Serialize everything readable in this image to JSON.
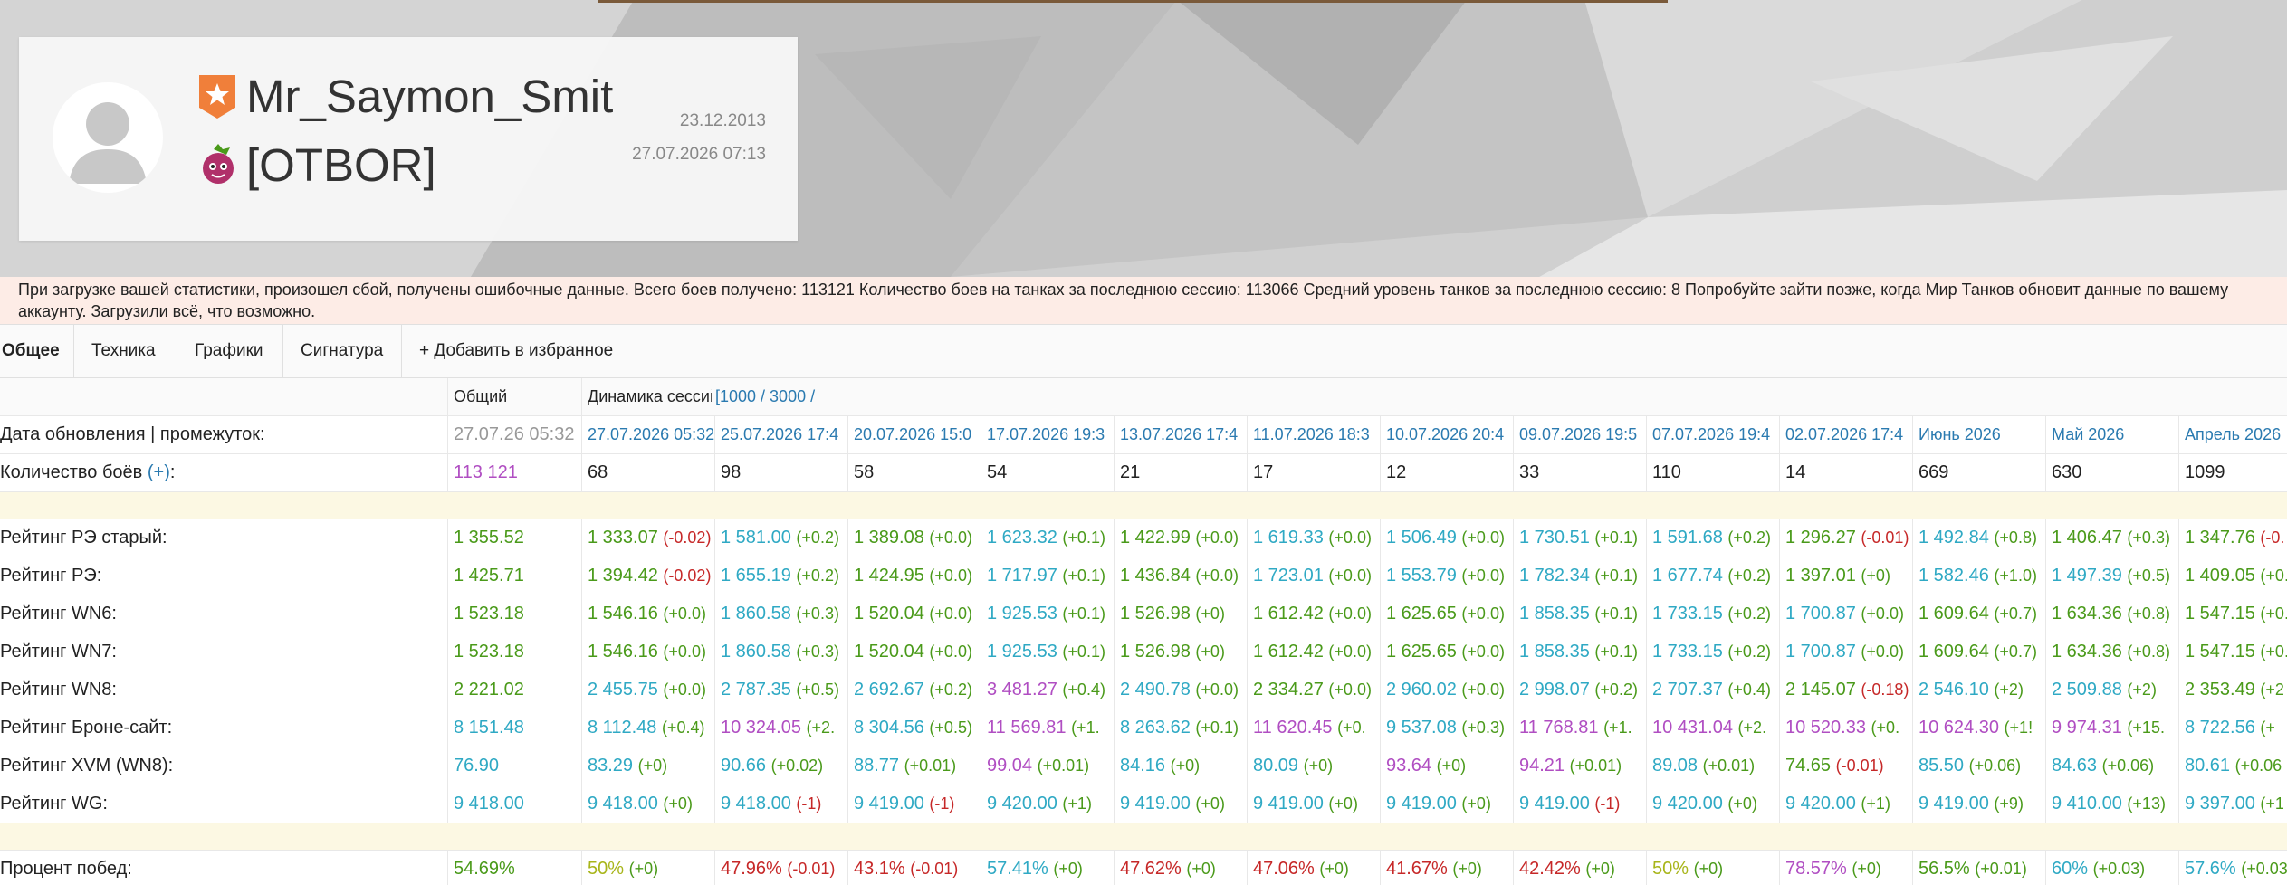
{
  "player": {
    "nickname": "Mr_Saymon_Smit",
    "clan": "[OTBOR]",
    "registered": "23.12.2013",
    "last_battle": "27.07.2026 07:13"
  },
  "alert": "При загрузке вашей статистики, произошел сбой, получены ошибочные данные. Всего боев получено: 113121 Количество боев на танках за последнюю сессию: 113066 Средний уровень танков за последнюю сессию: 8 Попробуйте зайти позже, когда Мир Танков обновит данные по вашему аккаунту. Загрузили всё, что возможно.",
  "tabs": [
    "Общее",
    "Техника",
    "Графики",
    "Сигнатура",
    "+ Добавить в избранное"
  ],
  "table": {
    "header": {
      "total": "Общий",
      "dynamics": "Динамика сессий",
      "ranges": "[1000 / 3000 /"
    },
    "update_label": "Дата обновления | промежуток:",
    "update_total": "27.07.26 05:32",
    "update_dates": [
      "27.07.2026 05:32",
      "25.07.2026 17:4",
      "20.07.2026 15:0",
      "17.07.2026 19:3",
      "13.07.2026 17:4",
      "11.07.2026 18:3",
      "10.07.2026 20:4",
      "09.07.2026 19:5",
      "07.07.2026 19:4",
      "02.07.2026 17:4",
      "Июнь 2026",
      "Май 2026",
      "Апрель 2026"
    ],
    "battles_label": "Количество боёв",
    "battles_plus": "(+)",
    "battles_colon": ":",
    "battles_total": "113 121",
    "battles": [
      "68",
      "98",
      "58",
      "54",
      "21",
      "17",
      "12",
      "33",
      "110",
      "14",
      "669",
      "630",
      "1099"
    ],
    "rows": [
      {
        "label": "Рейтинг РЭ старый:",
        "total": "1 355.52",
        "total_color": "#4a9a1a",
        "cells": [
          {
            "v": "1 333.07",
            "d": "(-0.02)",
            "c": "#4a9a1a",
            "dc": "#c62828"
          },
          {
            "v": "1 581.00",
            "d": "(+0.2)",
            "c": "#2fa9c4",
            "dc": "#4a9a1a"
          },
          {
            "v": "1 389.08",
            "d": "(+0.0)",
            "c": "#4a9a1a",
            "dc": "#4a9a1a"
          },
          {
            "v": "1 623.32",
            "d": "(+0.1)",
            "c": "#2fa9c4",
            "dc": "#4a9a1a"
          },
          {
            "v": "1 422.99",
            "d": "(+0.0)",
            "c": "#4a9a1a",
            "dc": "#4a9a1a"
          },
          {
            "v": "1 619.33",
            "d": "(+0.0)",
            "c": "#2fa9c4",
            "dc": "#4a9a1a"
          },
          {
            "v": "1 506.49",
            "d": "(+0.0)",
            "c": "#2fa9c4",
            "dc": "#4a9a1a"
          },
          {
            "v": "1 730.51",
            "d": "(+0.1)",
            "c": "#2fa9c4",
            "dc": "#4a9a1a"
          },
          {
            "v": "1 591.68",
            "d": "(+0.2)",
            "c": "#2fa9c4",
            "dc": "#4a9a1a"
          },
          {
            "v": "1 296.27",
            "d": "(-0.01)",
            "c": "#4a9a1a",
            "dc": "#c62828"
          },
          {
            "v": "1 492.84",
            "d": "(+0.8)",
            "c": "#2fa9c4",
            "dc": "#4a9a1a"
          },
          {
            "v": "1 406.47",
            "d": "(+0.3)",
            "c": "#4a9a1a",
            "dc": "#4a9a1a"
          },
          {
            "v": "1 347.76",
            "d": "(-0.",
            "c": "#4a9a1a",
            "dc": "#c62828"
          }
        ]
      },
      {
        "label": "Рейтинг РЭ:",
        "total": "1 425.71",
        "total_color": "#4a9a1a",
        "cells": [
          {
            "v": "1 394.42",
            "d": "(-0.02)",
            "c": "#4a9a1a",
            "dc": "#c62828"
          },
          {
            "v": "1 655.19",
            "d": "(+0.2)",
            "c": "#2fa9c4",
            "dc": "#4a9a1a"
          },
          {
            "v": "1 424.95",
            "d": "(+0.0)",
            "c": "#4a9a1a",
            "dc": "#4a9a1a"
          },
          {
            "v": "1 717.97",
            "d": "(+0.1)",
            "c": "#2fa9c4",
            "dc": "#4a9a1a"
          },
          {
            "v": "1 436.84",
            "d": "(+0.0)",
            "c": "#4a9a1a",
            "dc": "#4a9a1a"
          },
          {
            "v": "1 723.01",
            "d": "(+0.0)",
            "c": "#2fa9c4",
            "dc": "#4a9a1a"
          },
          {
            "v": "1 553.79",
            "d": "(+0.0)",
            "c": "#2fa9c4",
            "dc": "#4a9a1a"
          },
          {
            "v": "1 782.34",
            "d": "(+0.1)",
            "c": "#2fa9c4",
            "dc": "#4a9a1a"
          },
          {
            "v": "1 677.74",
            "d": "(+0.2)",
            "c": "#2fa9c4",
            "dc": "#4a9a1a"
          },
          {
            "v": "1 397.01",
            "d": "(+0)",
            "c": "#4a9a1a",
            "dc": "#4a9a1a"
          },
          {
            "v": "1 582.46",
            "d": "(+1.0)",
            "c": "#2fa9c4",
            "dc": "#4a9a1a"
          },
          {
            "v": "1 497.39",
            "d": "(+0.5)",
            "c": "#2fa9c4",
            "dc": "#4a9a1a"
          },
          {
            "v": "1 409.05",
            "d": "(+0.",
            "c": "#4a9a1a",
            "dc": "#4a9a1a"
          }
        ]
      },
      {
        "label": "Рейтинг WN6:",
        "total": "1 523.18",
        "total_color": "#4a9a1a",
        "cells": [
          {
            "v": "1 546.16",
            "d": "(+0.0)",
            "c": "#4a9a1a",
            "dc": "#4a9a1a"
          },
          {
            "v": "1 860.58",
            "d": "(+0.3)",
            "c": "#2fa9c4",
            "dc": "#4a9a1a"
          },
          {
            "v": "1 520.04",
            "d": "(+0.0)",
            "c": "#4a9a1a",
            "dc": "#4a9a1a"
          },
          {
            "v": "1 925.53",
            "d": "(+0.1)",
            "c": "#2fa9c4",
            "dc": "#4a9a1a"
          },
          {
            "v": "1 526.98",
            "d": "(+0)",
            "c": "#4a9a1a",
            "dc": "#4a9a1a"
          },
          {
            "v": "1 612.42",
            "d": "(+0.0)",
            "c": "#4a9a1a",
            "dc": "#4a9a1a"
          },
          {
            "v": "1 625.65",
            "d": "(+0.0)",
            "c": "#4a9a1a",
            "dc": "#4a9a1a"
          },
          {
            "v": "1 858.35",
            "d": "(+0.1)",
            "c": "#2fa9c4",
            "dc": "#4a9a1a"
          },
          {
            "v": "1 733.15",
            "d": "(+0.2)",
            "c": "#2fa9c4",
            "dc": "#4a9a1a"
          },
          {
            "v": "1 700.87",
            "d": "(+0.0)",
            "c": "#2fa9c4",
            "dc": "#4a9a1a"
          },
          {
            "v": "1 609.64",
            "d": "(+0.7)",
            "c": "#4a9a1a",
            "dc": "#4a9a1a"
          },
          {
            "v": "1 634.36",
            "d": "(+0.8)",
            "c": "#4a9a1a",
            "dc": "#4a9a1a"
          },
          {
            "v": "1 547.15",
            "d": "(+0.",
            "c": "#4a9a1a",
            "dc": "#4a9a1a"
          }
        ]
      },
      {
        "label": "Рейтинг WN7:",
        "total": "1 523.18",
        "total_color": "#4a9a1a",
        "cells": [
          {
            "v": "1 546.16",
            "d": "(+0.0)",
            "c": "#4a9a1a",
            "dc": "#4a9a1a"
          },
          {
            "v": "1 860.58",
            "d": "(+0.3)",
            "c": "#2fa9c4",
            "dc": "#4a9a1a"
          },
          {
            "v": "1 520.04",
            "d": "(+0.0)",
            "c": "#4a9a1a",
            "dc": "#4a9a1a"
          },
          {
            "v": "1 925.53",
            "d": "(+0.1)",
            "c": "#2fa9c4",
            "dc": "#4a9a1a"
          },
          {
            "v": "1 526.98",
            "d": "(+0)",
            "c": "#4a9a1a",
            "dc": "#4a9a1a"
          },
          {
            "v": "1 612.42",
            "d": "(+0.0)",
            "c": "#4a9a1a",
            "dc": "#4a9a1a"
          },
          {
            "v": "1 625.65",
            "d": "(+0.0)",
            "c": "#4a9a1a",
            "dc": "#4a9a1a"
          },
          {
            "v": "1 858.35",
            "d": "(+0.1)",
            "c": "#2fa9c4",
            "dc": "#4a9a1a"
          },
          {
            "v": "1 733.15",
            "d": "(+0.2)",
            "c": "#2fa9c4",
            "dc": "#4a9a1a"
          },
          {
            "v": "1 700.87",
            "d": "(+0.0)",
            "c": "#2fa9c4",
            "dc": "#4a9a1a"
          },
          {
            "v": "1 609.64",
            "d": "(+0.7)",
            "c": "#4a9a1a",
            "dc": "#4a9a1a"
          },
          {
            "v": "1 634.36",
            "d": "(+0.8)",
            "c": "#4a9a1a",
            "dc": "#4a9a1a"
          },
          {
            "v": "1 547.15",
            "d": "(+0.",
            "c": "#4a9a1a",
            "dc": "#4a9a1a"
          }
        ]
      },
      {
        "label": "Рейтинг WN8:",
        "total": "2 221.02",
        "total_color": "#4a9a1a",
        "cells": [
          {
            "v": "2 455.75",
            "d": "(+0.0)",
            "c": "#2fa9c4",
            "dc": "#4a9a1a"
          },
          {
            "v": "2 787.35",
            "d": "(+0.5)",
            "c": "#2fa9c4",
            "dc": "#4a9a1a"
          },
          {
            "v": "2 692.67",
            "d": "(+0.2)",
            "c": "#2fa9c4",
            "dc": "#4a9a1a"
          },
          {
            "v": "3 481.27",
            "d": "(+0.4)",
            "c": "#b04ec2",
            "dc": "#4a9a1a"
          },
          {
            "v": "2 490.78",
            "d": "(+0.0)",
            "c": "#2fa9c4",
            "dc": "#4a9a1a"
          },
          {
            "v": "2 334.27",
            "d": "(+0.0)",
            "c": "#4a9a1a",
            "dc": "#4a9a1a"
          },
          {
            "v": "2 960.02",
            "d": "(+0.0)",
            "c": "#2fa9c4",
            "dc": "#4a9a1a"
          },
          {
            "v": "2 998.07",
            "d": "(+0.2)",
            "c": "#2fa9c4",
            "dc": "#4a9a1a"
          },
          {
            "v": "2 707.37",
            "d": "(+0.4)",
            "c": "#2fa9c4",
            "dc": "#4a9a1a"
          },
          {
            "v": "2 145.07",
            "d": "(-0.18)",
            "c": "#4a9a1a",
            "dc": "#c62828"
          },
          {
            "v": "2 546.10",
            "d": "(+2)",
            "c": "#2fa9c4",
            "dc": "#4a9a1a"
          },
          {
            "v": "2 509.88",
            "d": "(+2)",
            "c": "#2fa9c4",
            "dc": "#4a9a1a"
          },
          {
            "v": "2 353.49",
            "d": "(+2",
            "c": "#4a9a1a",
            "dc": "#4a9a1a"
          }
        ]
      },
      {
        "label": "Рейтинг Броне-сайт:",
        "total": "8 151.48",
        "total_color": "#2fa9c4",
        "cells": [
          {
            "v": "8 112.48",
            "d": "(+0.4)",
            "c": "#2fa9c4",
            "dc": "#4a9a1a"
          },
          {
            "v": "10 324.05",
            "d": "(+2.",
            "c": "#b04ec2",
            "dc": "#4a9a1a"
          },
          {
            "v": "8 304.56",
            "d": "(+0.5)",
            "c": "#2fa9c4",
            "dc": "#4a9a1a"
          },
          {
            "v": "11 569.81",
            "d": "(+1.",
            "c": "#b04ec2",
            "dc": "#4a9a1a"
          },
          {
            "v": "8 263.62",
            "d": "(+0.1)",
            "c": "#2fa9c4",
            "dc": "#4a9a1a"
          },
          {
            "v": "11 620.45",
            "d": "(+0.",
            "c": "#b04ec2",
            "dc": "#4a9a1a"
          },
          {
            "v": "9 537.08",
            "d": "(+0.3)",
            "c": "#2fa9c4",
            "dc": "#4a9a1a"
          },
          {
            "v": "11 768.81",
            "d": "(+1.",
            "c": "#b04ec2",
            "dc": "#4a9a1a"
          },
          {
            "v": "10 431.04",
            "d": "(+2.",
            "c": "#b04ec2",
            "dc": "#4a9a1a"
          },
          {
            "v": "10 520.33",
            "d": "(+0.",
            "c": "#b04ec2",
            "dc": "#4a9a1a"
          },
          {
            "v": "10 624.30",
            "d": "(+1!",
            "c": "#b04ec2",
            "dc": "#4a9a1a"
          },
          {
            "v": "9 974.31",
            "d": "(+15.",
            "c": "#b04ec2",
            "dc": "#4a9a1a"
          },
          {
            "v": "8 722.56",
            "d": "(+",
            "c": "#2fa9c4",
            "dc": "#4a9a1a"
          }
        ]
      },
      {
        "label": "Рейтинг XVM (WN8):",
        "total": "76.90",
        "total_color": "#2fa9c4",
        "cells": [
          {
            "v": "83.29",
            "d": "(+0)",
            "c": "#2fa9c4",
            "dc": "#4a9a1a"
          },
          {
            "v": "90.66",
            "d": "(+0.02)",
            "c": "#2fa9c4",
            "dc": "#4a9a1a"
          },
          {
            "v": "88.77",
            "d": "(+0.01)",
            "c": "#2fa9c4",
            "dc": "#4a9a1a"
          },
          {
            "v": "99.04",
            "d": "(+0.01)",
            "c": "#b04ec2",
            "dc": "#4a9a1a"
          },
          {
            "v": "84.16",
            "d": "(+0)",
            "c": "#2fa9c4",
            "dc": "#4a9a1a"
          },
          {
            "v": "80.09",
            "d": "(+0)",
            "c": "#2fa9c4",
            "dc": "#4a9a1a"
          },
          {
            "v": "93.64",
            "d": "(+0)",
            "c": "#b04ec2",
            "dc": "#4a9a1a"
          },
          {
            "v": "94.21",
            "d": "(+0.01)",
            "c": "#b04ec2",
            "dc": "#4a9a1a"
          },
          {
            "v": "89.08",
            "d": "(+0.01)",
            "c": "#2fa9c4",
            "dc": "#4a9a1a"
          },
          {
            "v": "74.65",
            "d": "(-0.01)",
            "c": "#4a9a1a",
            "dc": "#c62828"
          },
          {
            "v": "85.50",
            "d": "(+0.06)",
            "c": "#2fa9c4",
            "dc": "#4a9a1a"
          },
          {
            "v": "84.63",
            "d": "(+0.06)",
            "c": "#2fa9c4",
            "dc": "#4a9a1a"
          },
          {
            "v": "80.61",
            "d": "(+0.06",
            "c": "#2fa9c4",
            "dc": "#4a9a1a"
          }
        ]
      },
      {
        "label": "Рейтинг WG:",
        "total": "9 418.00",
        "total_color": "#2fa9c4",
        "cells": [
          {
            "v": "9 418.00",
            "d": "(+0)",
            "c": "#2fa9c4",
            "dc": "#4a9a1a"
          },
          {
            "v": "9 418.00",
            "d": "(-1)",
            "c": "#2fa9c4",
            "dc": "#c62828"
          },
          {
            "v": "9 419.00",
            "d": "(-1)",
            "c": "#2fa9c4",
            "dc": "#c62828"
          },
          {
            "v": "9 420.00",
            "d": "(+1)",
            "c": "#2fa9c4",
            "dc": "#4a9a1a"
          },
          {
            "v": "9 419.00",
            "d": "(+0)",
            "c": "#2fa9c4",
            "dc": "#4a9a1a"
          },
          {
            "v": "9 419.00",
            "d": "(+0)",
            "c": "#2fa9c4",
            "dc": "#4a9a1a"
          },
          {
            "v": "9 419.00",
            "d": "(+0)",
            "c": "#2fa9c4",
            "dc": "#4a9a1a"
          },
          {
            "v": "9 419.00",
            "d": "(-1)",
            "c": "#2fa9c4",
            "dc": "#c62828"
          },
          {
            "v": "9 420.00",
            "d": "(+0)",
            "c": "#2fa9c4",
            "dc": "#4a9a1a"
          },
          {
            "v": "9 420.00",
            "d": "(+1)",
            "c": "#2fa9c4",
            "dc": "#4a9a1a"
          },
          {
            "v": "9 419.00",
            "d": "(+9)",
            "c": "#2fa9c4",
            "dc": "#4a9a1a"
          },
          {
            "v": "9 410.00",
            "d": "(+13)",
            "c": "#2fa9c4",
            "dc": "#4a9a1a"
          },
          {
            "v": "9 397.00",
            "d": "(+1",
            "c": "#2fa9c4",
            "dc": "#4a9a1a"
          }
        ]
      }
    ],
    "winrate": {
      "label": "Процент побед:",
      "total": "54.69%",
      "total_color": "#4a9a1a",
      "cells": [
        {
          "v": "50%",
          "d": "(+0)",
          "c": "#a8b51a",
          "dc": "#4a9a1a"
        },
        {
          "v": "47.96%",
          "d": "(-0.01)",
          "c": "#c62828",
          "dc": "#c62828"
        },
        {
          "v": "43.1%",
          "d": "(-0.01)",
          "c": "#c62828",
          "dc": "#c62828"
        },
        {
          "v": "57.41%",
          "d": "(+0)",
          "c": "#2fa9c4",
          "dc": "#4a9a1a"
        },
        {
          "v": "47.62%",
          "d": "(+0)",
          "c": "#c62828",
          "dc": "#4a9a1a"
        },
        {
          "v": "47.06%",
          "d": "(+0)",
          "c": "#c62828",
          "dc": "#4a9a1a"
        },
        {
          "v": "41.67%",
          "d": "(+0)",
          "c": "#c62828",
          "dc": "#4a9a1a"
        },
        {
          "v": "42.42%",
          "d": "(+0)",
          "c": "#c62828",
          "dc": "#4a9a1a"
        },
        {
          "v": "50%",
          "d": "(+0)",
          "c": "#a8b51a",
          "dc": "#4a9a1a"
        },
        {
          "v": "78.57%",
          "d": "(+0)",
          "c": "#b04ec2",
          "dc": "#4a9a1a"
        },
        {
          "v": "56.5%",
          "d": "(+0.01)",
          "c": "#4a9a1a",
          "dc": "#4a9a1a"
        },
        {
          "v": "60%",
          "d": "(+0.03)",
          "c": "#2fa9c4",
          "dc": "#4a9a1a"
        },
        {
          "v": "57.6%",
          "d": "(+0.03",
          "c": "#2fa9c4",
          "dc": "#4a9a1a"
        }
      ]
    }
  },
  "colors": {
    "green": "#4a9a1a",
    "blue": "#2fa9c4",
    "purple": "#b04ec2",
    "red": "#c62828",
    "olive": "#a8b51a",
    "link": "#2a7ab0",
    "badge": "#f07f3a",
    "alert_bg": "#fdece6",
    "blank_row": "#fcf8e3"
  },
  "icons": {
    "rank": "star-badge-icon",
    "clan": "clan-emblem-icon",
    "avatar": "user-avatar-icon"
  }
}
